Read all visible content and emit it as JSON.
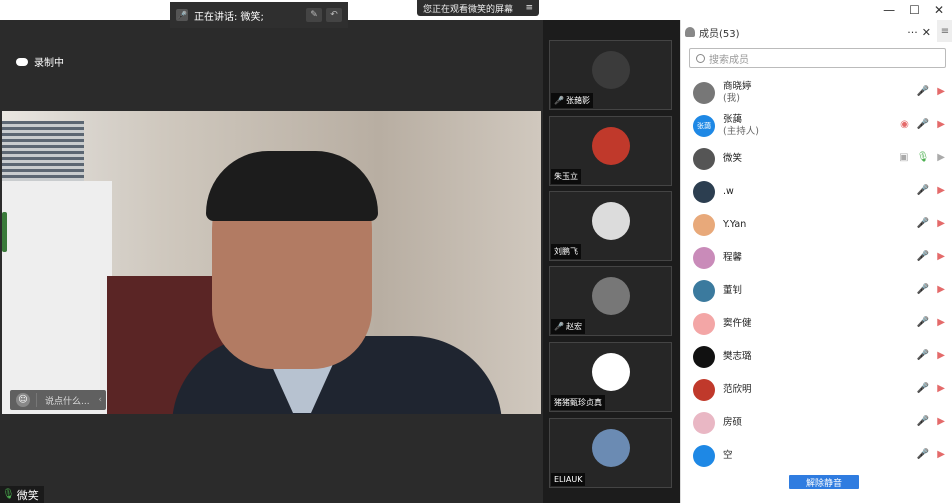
{
  "meeting": {
    "speaking_label": "正在讲话: 微笑;",
    "screen_banner": "您正在观看微笑的屏幕",
    "recording": "录制中",
    "chat_placeholder": "说点什么...",
    "active_speaker": "微笑"
  },
  "tiles": [
    {
      "name": "张藹影",
      "muted": true,
      "color": "#3b3b3b"
    },
    {
      "name": "朱玉立",
      "muted": false,
      "color": "#c0392b"
    },
    {
      "name": "刘鹏飞",
      "muted": false,
      "color": "#dcdcdc"
    },
    {
      "name": "赵宏",
      "muted": true,
      "color": "#777777"
    },
    {
      "name": "猪猪甄珍贞真",
      "muted": false,
      "color": "#ffffff"
    },
    {
      "name": "ELIAUK",
      "muted": false,
      "color": "#6b8bb3"
    }
  ],
  "panel": {
    "title": "成员(53)",
    "more": "···",
    "close": "✕",
    "menu": "≡",
    "search_placeholder": "搜索成员",
    "unmute_all": "解除静音"
  },
  "window": {
    "minimize": "—",
    "maximize": "☐",
    "close": "✕"
  },
  "members": [
    {
      "name": "商晓婷",
      "sub": "(我)",
      "color": "#777777"
    },
    {
      "name": "张藹",
      "sub": "(主持人)",
      "color": "#1e88e5",
      "avatar_text": "张藹"
    },
    {
      "name": "微笑",
      "sub": "",
      "color": "#555555"
    },
    {
      "name": ".w",
      "sub": "",
      "color": "#2c3e50"
    },
    {
      "name": "Y.Yan",
      "sub": "",
      "color": "#e8a97a"
    },
    {
      "name": "程馨",
      "sub": "",
      "color": "#c98bb9"
    },
    {
      "name": "董钊",
      "sub": "",
      "color": "#3b7a9e"
    },
    {
      "name": "窦仵健",
      "sub": "",
      "color": "#f3a6a6"
    },
    {
      "name": "樊志璐",
      "sub": "",
      "color": "#111111"
    },
    {
      "name": "范欣明",
      "sub": "",
      "color": "#c0392b"
    },
    {
      "name": "房硕",
      "sub": "",
      "color": "#e9b7c4"
    },
    {
      "name": "空",
      "sub": "",
      "color": "#1e88e5"
    }
  ]
}
